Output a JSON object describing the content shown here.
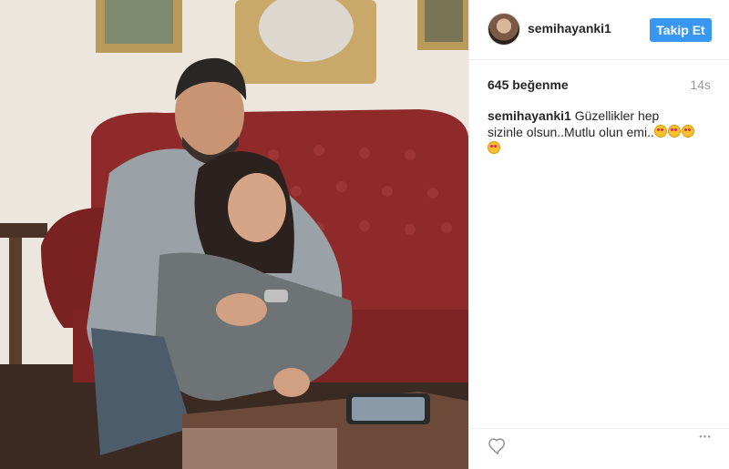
{
  "post": {
    "username": "semihayanki1",
    "follow_label": "Takip Et",
    "likes": "645 beğenme",
    "time": "14s",
    "caption": {
      "author": "semihayanki1",
      "text": "Güzellikler hep sizinle olsun..Mutlu olun emi..",
      "emoji_count": 4
    }
  },
  "colors": {
    "accent": "#3897f0",
    "sofa": "#8e2a2a"
  },
  "icons": {
    "like": "heart-icon",
    "more": "more-options-icon"
  }
}
